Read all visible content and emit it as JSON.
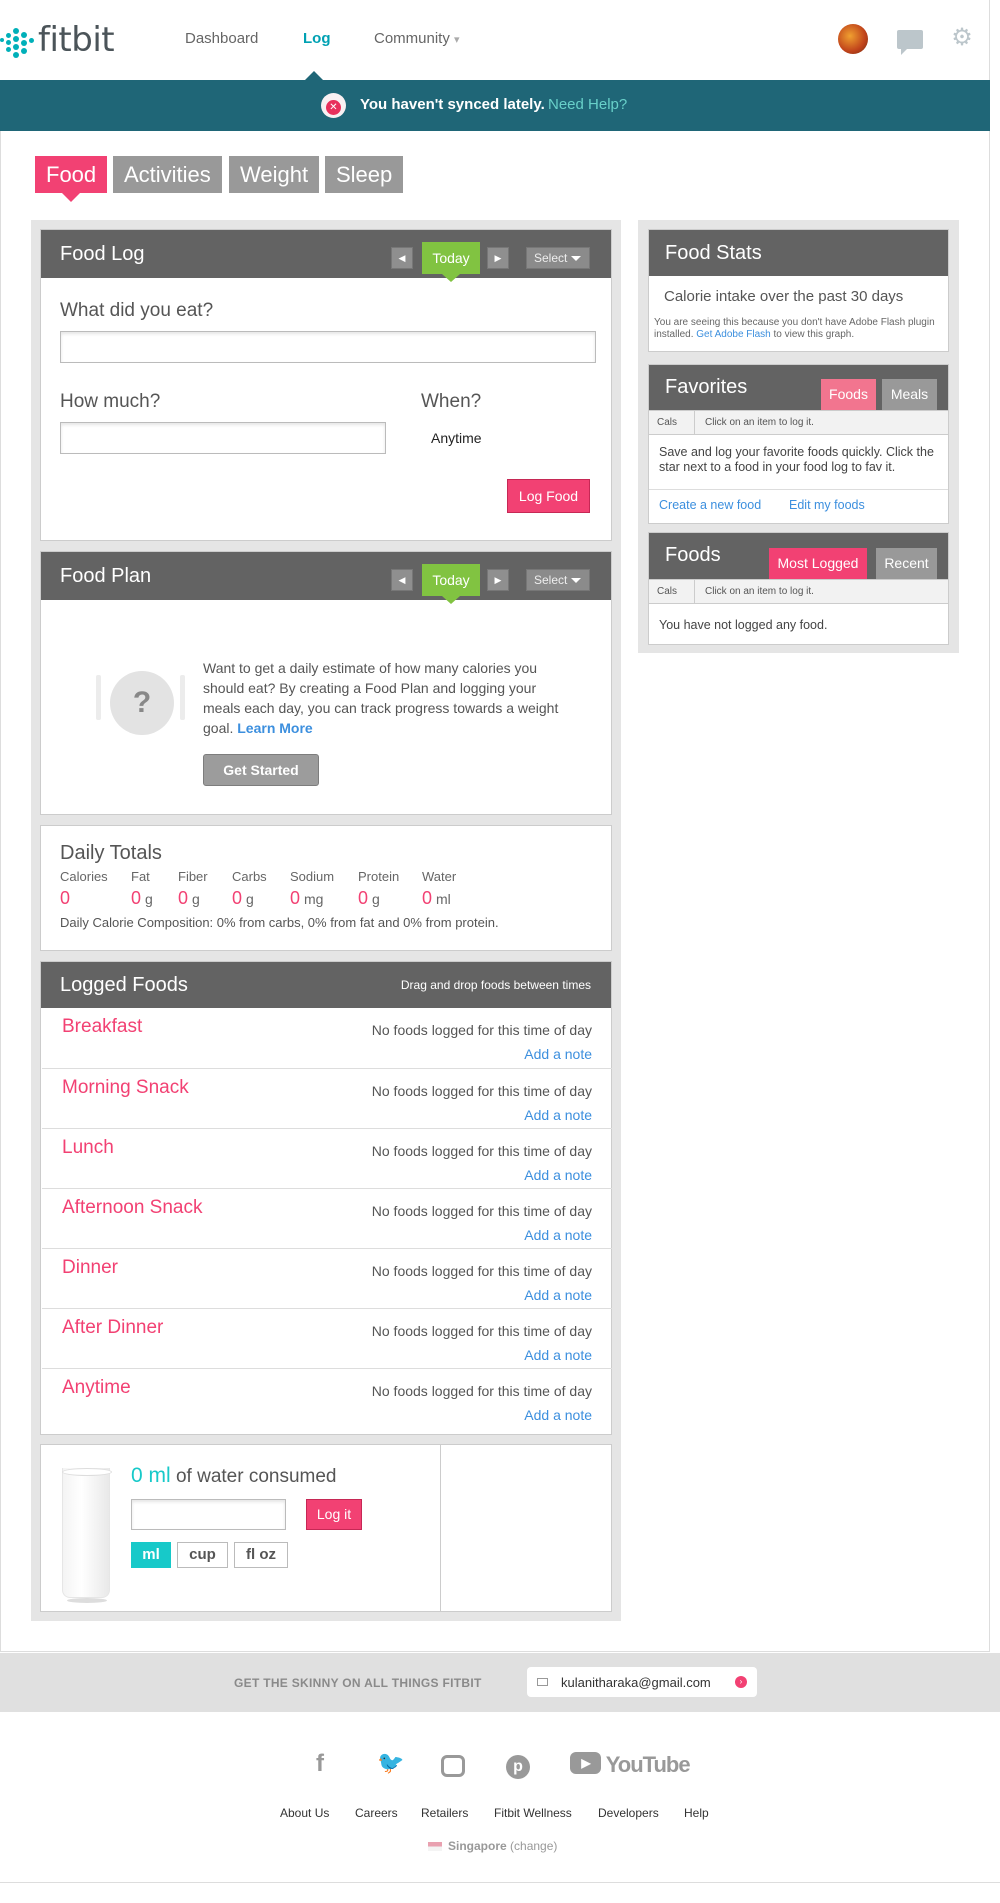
{
  "header": {
    "logo_text": "fitbit",
    "nav": [
      {
        "label": "Dashboard"
      },
      {
        "label": "Log"
      },
      {
        "label": "Community"
      }
    ],
    "community_caret": "▾",
    "gear_glyph": "⚙"
  },
  "banner": {
    "message": "You haven't synced lately.",
    "help_link": "Need Help?"
  },
  "tabs": [
    "Food",
    "Activities",
    "Weight",
    "Sleep"
  ],
  "food_log": {
    "title": "Food Log",
    "today_label": "Today",
    "select_label": "Select",
    "what_label": "What did you eat?",
    "how_much_label": "How much?",
    "when_label": "When?",
    "when_value": "Anytime",
    "log_button": "Log Food"
  },
  "food_plan": {
    "title": "Food Plan",
    "today_label": "Today",
    "select_label": "Select",
    "question_glyph": "?",
    "description": "Want to get a daily estimate of how many calories you should eat? By creating a Food Plan and logging your meals each day, you can track progress towards a weight goal.",
    "learn_more": "Learn More",
    "get_started": "Get Started"
  },
  "daily_totals": {
    "title": "Daily Totals",
    "items": [
      {
        "label": "Calories",
        "value": "0",
        "unit": ""
      },
      {
        "label": "Fat",
        "value": "0",
        "unit": "g"
      },
      {
        "label": "Fiber",
        "value": "0",
        "unit": "g"
      },
      {
        "label": "Carbs",
        "value": "0",
        "unit": "g"
      },
      {
        "label": "Sodium",
        "value": "0",
        "unit": "mg"
      },
      {
        "label": "Protein",
        "value": "0",
        "unit": "g"
      },
      {
        "label": "Water",
        "value": "0",
        "unit": "ml"
      }
    ],
    "composition": "Daily Calorie Composition: 0% from carbs, 0% from fat and 0% from protein."
  },
  "logged_foods": {
    "title": "Logged Foods",
    "hint": "Drag and drop foods between times",
    "meals": [
      {
        "name": "Breakfast",
        "status": "No foods logged for this time of day",
        "note": "Add a note"
      },
      {
        "name": "Morning Snack",
        "status": "No foods logged for this time of day",
        "note": "Add a note"
      },
      {
        "name": "Lunch",
        "status": "No foods logged for this time of day",
        "note": "Add a note"
      },
      {
        "name": "Afternoon Snack",
        "status": "No foods logged for this time of day",
        "note": "Add a note"
      },
      {
        "name": "Dinner",
        "status": "No foods logged for this time of day",
        "note": "Add a note"
      },
      {
        "name": "After Dinner",
        "status": "No foods logged for this time of day",
        "note": "Add a note"
      },
      {
        "name": "Anytime",
        "status": "No foods logged for this time of day",
        "note": "Add a note"
      }
    ]
  },
  "water": {
    "amount": "0 ml",
    "suffix": "of water consumed",
    "log_button": "Log it",
    "units": [
      "ml",
      "cup",
      "fl oz"
    ],
    "selected_unit": "ml"
  },
  "food_stats": {
    "title": "Food Stats",
    "subtitle": "Calorie intake over the past 30 days",
    "flash_notice": "You are seeing this because you don't have Adobe Flash plugin installed.",
    "flash_link": "Get Adobe Flash",
    "flash_suffix": "to view this graph."
  },
  "favorites": {
    "title": "Favorites",
    "tabs": [
      "Foods",
      "Meals"
    ],
    "cals_label": "Cals",
    "hint": "Click on an item to log it.",
    "message": "Save and log your favorite foods quickly. Click the star next to a food in your food log to fav it.",
    "create_link": "Create a new food",
    "edit_link": "Edit my foods"
  },
  "foods": {
    "title": "Foods",
    "tabs": [
      "Most Logged",
      "Recent"
    ],
    "cals_label": "Cals",
    "hint": "Click on an item to log it.",
    "message": "You have not logged any food."
  },
  "footer": {
    "subscribe_label": "GET THE SKINNY ON ALL THINGS FITBIT",
    "email": "kulanitharaka@gmail.com",
    "social": [
      "facebook",
      "twitter",
      "instagram",
      "pinterest",
      "youtube"
    ],
    "youtube_label": "YouTube",
    "links": [
      "About Us",
      "Careers",
      "Retailers",
      "Fitbit Wellness",
      "Developers",
      "Help"
    ],
    "region": "Singapore",
    "region_change": "change"
  },
  "colors": {
    "accent_pink": "#f24173",
    "banner_teal": "#1f6677",
    "today_green": "#81c341",
    "link_blue": "#3c8fde",
    "water_teal": "#17c9c9"
  }
}
